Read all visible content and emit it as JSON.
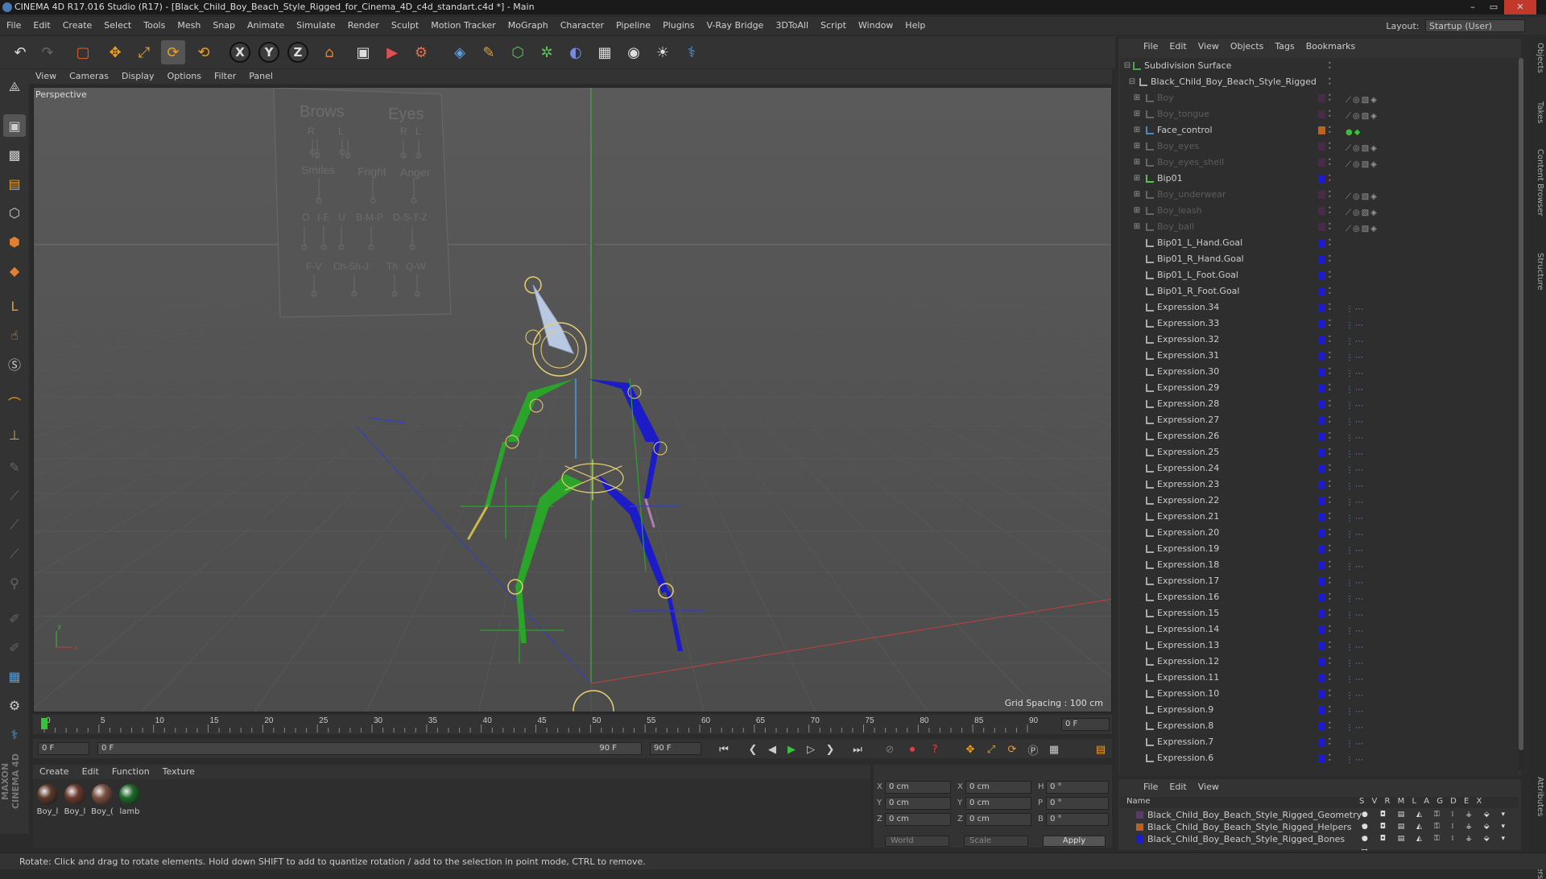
{
  "window": {
    "title": "CINEMA 4D R17.016 Studio (R17) - [Black_Child_Boy_Beach_Style_Rigged_for_Cinema_4D_c4d_standart.c4d *] - Main",
    "min_glyph": "–",
    "max_glyph": "▭",
    "close_glyph": "✕"
  },
  "menu": [
    "File",
    "Edit",
    "Create",
    "Select",
    "Tools",
    "Mesh",
    "Snap",
    "Animate",
    "Simulate",
    "Render",
    "Sculpt",
    "Motion Tracker",
    "MoGraph",
    "Character",
    "Pipeline",
    "Plugins",
    "V-Ray Bridge",
    "3DToAll",
    "Script",
    "Window",
    "Help"
  ],
  "layout": {
    "label": "Layout:",
    "value": "Startup (User)"
  },
  "toolbar": {
    "undo": "↶",
    "redo": "↷",
    "live_select": "▢",
    "move": "✥",
    "scale": "⤢",
    "rotate": "⟳",
    "rotate2": "⟲",
    "x": "X",
    "y": "Y",
    "z": "Z",
    "coord": "⌂",
    "render_view": "▣",
    "render_pic": "▶",
    "render_settings": "⚙",
    "cube": "◈",
    "pen": "✎",
    "nurbs": "⬡",
    "mograph": "✲",
    "deformer": "◐",
    "floor": "▦",
    "camera": "◉",
    "light": "☀",
    "python": "⚕"
  },
  "viewport": {
    "menu": [
      "View",
      "Cameras",
      "Display",
      "Options",
      "Filter",
      "Panel"
    ],
    "label": "Perspective",
    "grid_spacing": "Grid Spacing : 100 cm",
    "face_control": {
      "brows": "Brows",
      "eyes": "Eyes",
      "r": "R",
      "l": "L",
      "smiles": "Smiles",
      "fright": "Fright",
      "anger": "Anger",
      "o": "O",
      "ie": "I-E",
      "u": "U",
      "bmp": "B-M-P",
      "dstz": "D-S-T-Z",
      "fv": "F-V",
      "chshj": "Ch-Sh-J",
      "th": "Th",
      "qw": "Q-W"
    }
  },
  "timeline": {
    "ticks": [
      "0",
      "5",
      "10",
      "15",
      "20",
      "25",
      "30",
      "35",
      "40",
      "45",
      "50",
      "55",
      "60",
      "65",
      "70",
      "75",
      "80",
      "85",
      "90"
    ],
    "current": "0 F"
  },
  "transport": {
    "start": "0 F",
    "slider_left": "0 F",
    "slider_right": "90 F",
    "end": "90 F"
  },
  "materials": {
    "menu": [
      "Create",
      "Edit",
      "Function",
      "Texture"
    ],
    "items": [
      {
        "name": "Boy_l",
        "color": "#5a3a2a"
      },
      {
        "name": "Boy_l",
        "color": "#6a3b30"
      },
      {
        "name": "Boy_(",
        "color": "#7a5040"
      },
      {
        "name": "lamb",
        "color": "#1f6a2a"
      }
    ]
  },
  "coords": {
    "x1": "X",
    "x1v": "0 cm",
    "x2": "X",
    "x2v": "0 cm",
    "h": "H",
    "hv": "0 °",
    "y1": "Y",
    "y1v": "0 cm",
    "y2": "Y",
    "y2v": "0 cm",
    "p": "P",
    "pv": "0 °",
    "z1": "Z",
    "z1v": "0 cm",
    "z2": "Z",
    "z2v": "0 cm",
    "b": "B",
    "bv": "0 °",
    "world": "World",
    "scale": "Scale",
    "apply": "Apply"
  },
  "objects": {
    "menu": [
      "File",
      "Edit",
      "View",
      "Objects",
      "Tags",
      "Bookmarks"
    ],
    "rows": [
      {
        "label": "Subdivision Surface",
        "indent": 0,
        "swatch": "",
        "dim": false,
        "icon": "#4aa84a"
      },
      {
        "label": "Black_Child_Boy_Beach_Style_Rigged",
        "indent": 1,
        "swatch": "",
        "dim": false,
        "icon": "#aaa"
      },
      {
        "label": "Boy",
        "indent": 2,
        "swatch": "#4a2a4a",
        "dim": true,
        "icon": "#666"
      },
      {
        "label": "Boy_tongue",
        "indent": 2,
        "swatch": "#4a2a4a",
        "dim": true,
        "icon": "#666"
      },
      {
        "label": "Face_control",
        "indent": 2,
        "swatch": "#c0601a",
        "dim": false,
        "icon": "#4a8ac0"
      },
      {
        "label": "Boy_eyes",
        "indent": 2,
        "swatch": "#4a2a4a",
        "dim": true,
        "icon": "#666"
      },
      {
        "label": "Boy_eyes_shell",
        "indent": 2,
        "swatch": "#4a2a4a",
        "dim": true,
        "icon": "#666"
      },
      {
        "label": "Bip01",
        "indent": 2,
        "swatch": "#1b1bd0",
        "dim": false,
        "icon": "#5ac05a"
      },
      {
        "label": "Boy_underwear",
        "indent": 2,
        "swatch": "#4a2a4a",
        "dim": true,
        "icon": "#666"
      },
      {
        "label": "Boy_leash",
        "indent": 2,
        "swatch": "#4a2a4a",
        "dim": true,
        "icon": "#666"
      },
      {
        "label": "Boy_ball",
        "indent": 2,
        "swatch": "#4a2a4a",
        "dim": true,
        "icon": "#666"
      },
      {
        "label": "Bip01_L_Hand.Goal",
        "indent": 2,
        "swatch": "#1b1bd0",
        "dim": false,
        "icon": "#aaa"
      },
      {
        "label": "Bip01_R_Hand.Goal",
        "indent": 2,
        "swatch": "#1b1bd0",
        "dim": false,
        "icon": "#aaa"
      },
      {
        "label": "Bip01_L_Foot.Goal",
        "indent": 2,
        "swatch": "#1b1bd0",
        "dim": false,
        "icon": "#aaa"
      },
      {
        "label": "Bip01_R_Foot.Goal",
        "indent": 2,
        "swatch": "#1b1bd0",
        "dim": false,
        "icon": "#aaa"
      },
      {
        "label": "Expression.34",
        "indent": 2,
        "swatch": "#1b1bd0",
        "dim": false,
        "icon": "#aaa"
      },
      {
        "label": "Expression.33",
        "indent": 2,
        "swatch": "#1b1bd0",
        "dim": false,
        "icon": "#aaa"
      },
      {
        "label": "Expression.32",
        "indent": 2,
        "swatch": "#1b1bd0",
        "dim": false,
        "icon": "#aaa"
      },
      {
        "label": "Expression.31",
        "indent": 2,
        "swatch": "#1b1bd0",
        "dim": false,
        "icon": "#aaa"
      },
      {
        "label": "Expression.30",
        "indent": 2,
        "swatch": "#1b1bd0",
        "dim": false,
        "icon": "#aaa"
      },
      {
        "label": "Expression.29",
        "indent": 2,
        "swatch": "#1b1bd0",
        "dim": false,
        "icon": "#aaa"
      },
      {
        "label": "Expression.28",
        "indent": 2,
        "swatch": "#1b1bd0",
        "dim": false,
        "icon": "#aaa"
      },
      {
        "label": "Expression.27",
        "indent": 2,
        "swatch": "#1b1bd0",
        "dim": false,
        "icon": "#aaa"
      },
      {
        "label": "Expression.26",
        "indent": 2,
        "swatch": "#1b1bd0",
        "dim": false,
        "icon": "#aaa"
      },
      {
        "label": "Expression.25",
        "indent": 2,
        "swatch": "#1b1bd0",
        "dim": false,
        "icon": "#aaa"
      },
      {
        "label": "Expression.24",
        "indent": 2,
        "swatch": "#1b1bd0",
        "dim": false,
        "icon": "#aaa"
      },
      {
        "label": "Expression.23",
        "indent": 2,
        "swatch": "#1b1bd0",
        "dim": false,
        "icon": "#aaa"
      },
      {
        "label": "Expression.22",
        "indent": 2,
        "swatch": "#1b1bd0",
        "dim": false,
        "icon": "#aaa"
      },
      {
        "label": "Expression.21",
        "indent": 2,
        "swatch": "#1b1bd0",
        "dim": false,
        "icon": "#aaa"
      },
      {
        "label": "Expression.20",
        "indent": 2,
        "swatch": "#1b1bd0",
        "dim": false,
        "icon": "#aaa"
      },
      {
        "label": "Expression.19",
        "indent": 2,
        "swatch": "#1b1bd0",
        "dim": false,
        "icon": "#aaa"
      },
      {
        "label": "Expression.18",
        "indent": 2,
        "swatch": "#1b1bd0",
        "dim": false,
        "icon": "#aaa"
      },
      {
        "label": "Expression.17",
        "indent": 2,
        "swatch": "#1b1bd0",
        "dim": false,
        "icon": "#aaa"
      },
      {
        "label": "Expression.16",
        "indent": 2,
        "swatch": "#1b1bd0",
        "dim": false,
        "icon": "#aaa"
      },
      {
        "label": "Expression.15",
        "indent": 2,
        "swatch": "#1b1bd0",
        "dim": false,
        "icon": "#aaa"
      },
      {
        "label": "Expression.14",
        "indent": 2,
        "swatch": "#1b1bd0",
        "dim": false,
        "icon": "#aaa"
      },
      {
        "label": "Expression.13",
        "indent": 2,
        "swatch": "#1b1bd0",
        "dim": false,
        "icon": "#aaa"
      },
      {
        "label": "Expression.12",
        "indent": 2,
        "swatch": "#1b1bd0",
        "dim": false,
        "icon": "#aaa"
      },
      {
        "label": "Expression.11",
        "indent": 2,
        "swatch": "#1b1bd0",
        "dim": false,
        "icon": "#aaa"
      },
      {
        "label": "Expression.10",
        "indent": 2,
        "swatch": "#1b1bd0",
        "dim": false,
        "icon": "#aaa"
      },
      {
        "label": "Expression.9",
        "indent": 2,
        "swatch": "#1b1bd0",
        "dim": false,
        "icon": "#aaa"
      },
      {
        "label": "Expression.8",
        "indent": 2,
        "swatch": "#1b1bd0",
        "dim": false,
        "icon": "#aaa"
      },
      {
        "label": "Expression.7",
        "indent": 2,
        "swatch": "#1b1bd0",
        "dim": false,
        "icon": "#aaa"
      },
      {
        "label": "Expression.6",
        "indent": 2,
        "swatch": "#1b1bd0",
        "dim": false,
        "icon": "#aaa"
      }
    ]
  },
  "layers": {
    "menu": [
      "File",
      "Edit",
      "View"
    ],
    "header": {
      "name": "Name",
      "flags": "S V R M L A G D E X"
    },
    "rows": [
      {
        "name": "Black_Child_Boy_Beach_Style_Rigged_Geometry",
        "color": "#5a3a6a"
      },
      {
        "name": "Black_Child_Boy_Beach_Style_Rigged_Helpers",
        "color": "#c06020"
      },
      {
        "name": "Black_Child_Boy_Beach_Style_Rigged_Bones",
        "color": "#1b1bd0"
      }
    ],
    "flag_glyphs": "● ◘ ▤ ◭ ⚿ ⁞ ⚶ ⬙ ▾ ꟷ"
  },
  "side_tabs": [
    "Objects",
    "Takes",
    "Content Browser",
    "Structure",
    "Attributes",
    "Layers"
  ],
  "status": "Rotate: Click and drag to rotate elements. Hold down SHIFT to add to quantize rotation / add to the selection in point mode, CTRL to remove."
}
